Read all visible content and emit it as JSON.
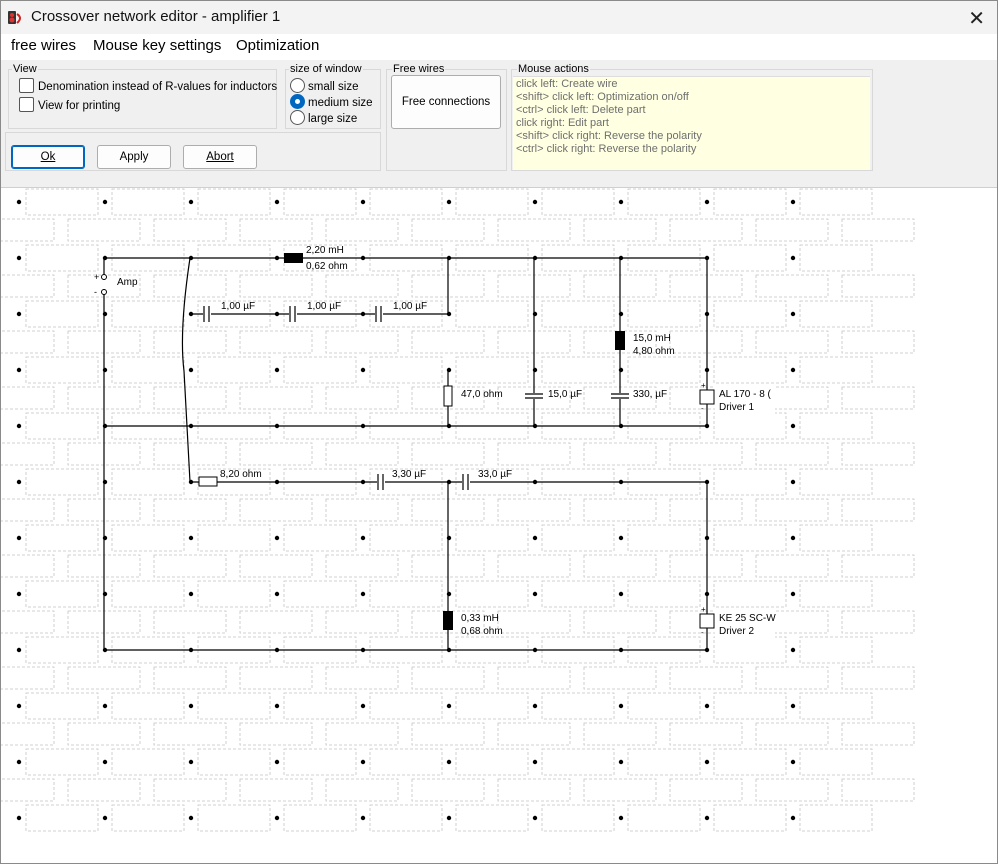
{
  "window": {
    "title": "Crossover network editor - amplifier 1",
    "close_glyph": "✕"
  },
  "menu": [
    {
      "label": "free wires",
      "name": "menu-free-wires"
    },
    {
      "label": "Mouse key settings",
      "name": "menu-mouse-key-settings"
    },
    {
      "label": "Optimization",
      "name": "menu-optimization"
    }
  ],
  "view": {
    "label": "View",
    "denomination": {
      "label": "Denomination instead of R-values for inductors",
      "checked": false
    },
    "print": {
      "label": "View for printing",
      "checked": false
    }
  },
  "size": {
    "label": "size of window",
    "options": [
      {
        "label": "small size",
        "selected": false
      },
      {
        "label": "medium size",
        "selected": true
      },
      {
        "label": "large size",
        "selected": false
      }
    ]
  },
  "free_wires": {
    "label": "Free wires",
    "button": "Free connections"
  },
  "mouse_actions": {
    "label": "Mouse actions",
    "lines": [
      "click left: Create wire",
      "<shift> click left: Optimization on/off",
      "<ctrl> click left: Delete part",
      "click right: Edit part",
      "<shift> click right: Reverse the polarity",
      "<ctrl> click right: Reverse the polarity"
    ]
  },
  "buttons": {
    "ok": "Ok",
    "apply": "Apply",
    "abort": "Abort"
  },
  "circuit": {
    "amp": {
      "label": "Amp",
      "plus": "+",
      "minus": "-"
    },
    "inductor1": {
      "line1": "2,20 mH",
      "line2": "0,62 ohm"
    },
    "cap1": "1,00 µF",
    "cap2": "1,00 µF",
    "cap3": "1,00 µF",
    "inductor2": {
      "line1": "15,0 mH",
      "line2": "4,80 ohm"
    },
    "resistor1": "47,0 ohm",
    "cap4": "15,0 µF",
    "cap5": "330, µF",
    "driver1": {
      "line1": "AL 170 - 8 (",
      "line2": "Driver 1"
    },
    "resistor2": "8,20 ohm",
    "cap6": "3,30 µF",
    "cap7": "33,0 µF",
    "inductor3": {
      "line1": "0,33 mH",
      "line2": "0,68 ohm"
    },
    "driver2": {
      "line1": "KE 25 SC-W",
      "line2": "Driver 2"
    }
  }
}
